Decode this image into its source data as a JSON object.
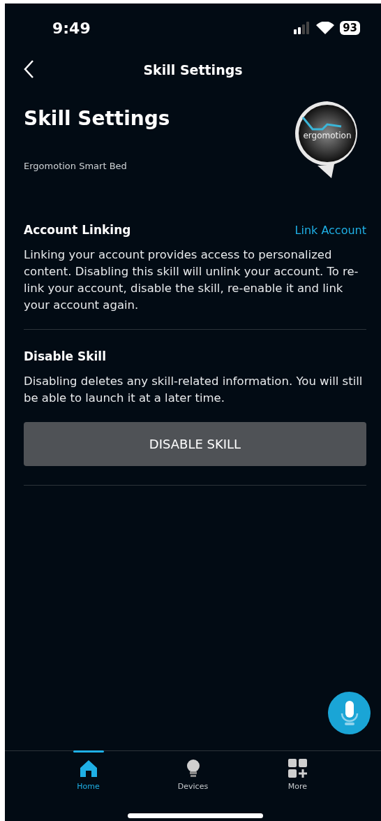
{
  "status_bar": {
    "time": "9:49",
    "battery": "93"
  },
  "nav": {
    "title": "Skill Settings"
  },
  "header": {
    "title": "Skill Settings",
    "subtitle": "Ergomotion Smart Bed",
    "logo_text": "ergomotion"
  },
  "sections": [
    {
      "kind": "link",
      "title": "Account Linking",
      "action": "Link Account",
      "body": "Linking your account provides access to personalized content. Disabling this skill will unlink your account. To re-link your account, disable the skill, re-enable it and link your account again."
    },
    {
      "kind": "button",
      "title": "Disable Skill",
      "body": "Disabling deletes any skill-related information. You will still be able to launch it at a later time.",
      "action": "DISABLE SKILL"
    }
  ],
  "tab_bar": [
    {
      "label": "Home",
      "kind": "home",
      "selected": true
    },
    {
      "label": "Devices",
      "kind": "bulb",
      "selected": false
    },
    {
      "label": "More",
      "kind": "grid",
      "selected": false
    }
  ]
}
